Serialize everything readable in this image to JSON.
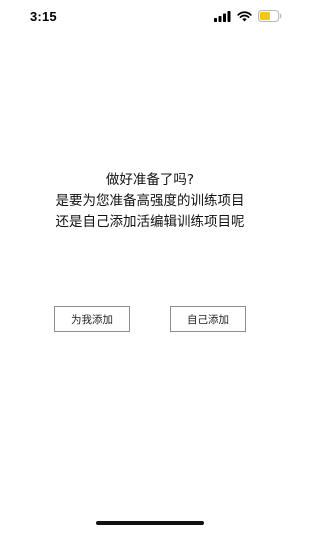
{
  "status_bar": {
    "time": "3:15",
    "icons": [
      "signal-icon",
      "wifi-icon",
      "battery-icon"
    ],
    "battery_color": "#f5c518"
  },
  "prompt": {
    "line1": "做好准备了吗?",
    "line2": "是要为您准备高强度的训练项目",
    "line3": "还是自己添加活编辑训练项目呢"
  },
  "buttons": {
    "add_for_me": "为我添加",
    "add_myself": "自己添加"
  }
}
